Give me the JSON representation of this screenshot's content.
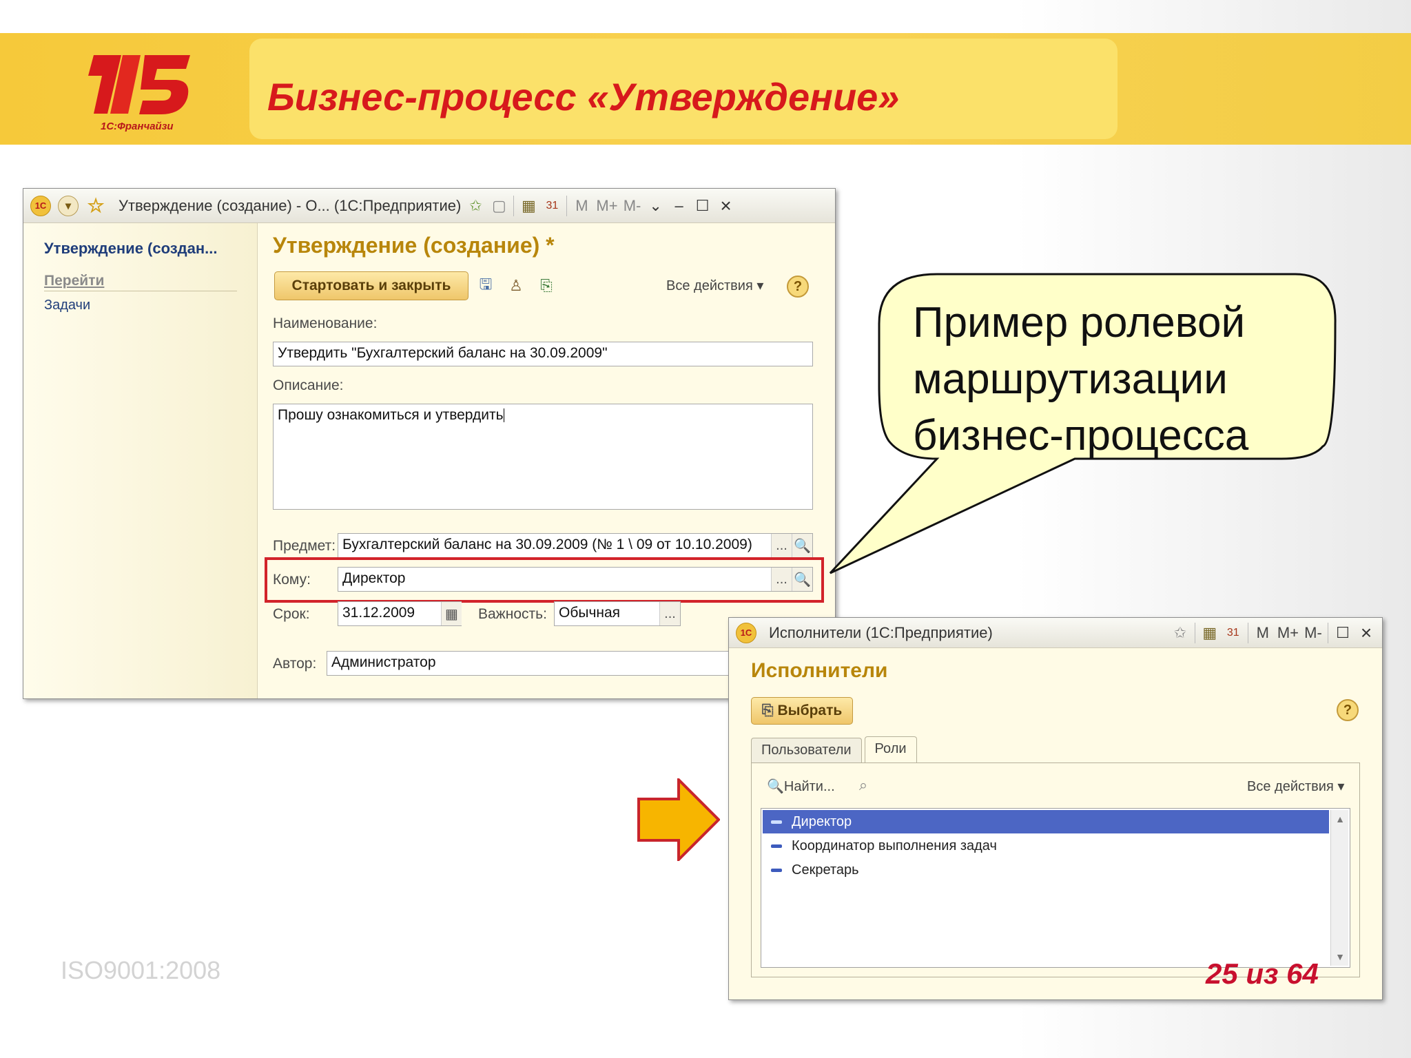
{
  "slide": {
    "title": "Бизнес-процесс «Утверждение»",
    "logo_text": "1С:Франчайзи",
    "iso": "ISO9001:2008",
    "page_num": "25 из 64",
    "callout": [
      "Пример ролевой",
      "маршрутизации",
      "бизнес-процесса"
    ]
  },
  "win1": {
    "title": "Утверждение (создание) - О... (1С:Предприятие)",
    "toolbar": [
      "M",
      "M+",
      "M-"
    ],
    "side": {
      "title": "Утверждение (создан...",
      "section": "Перейти",
      "link": "Задачи"
    },
    "form_title": "Утверждение (создание) *",
    "start_btn": "Стартовать и закрыть",
    "all_actions": "Все действия",
    "help": "?",
    "name_label": "Наименование:",
    "name_value": "Утвердить \"Бухгалтерский баланс на 30.09.2009\"",
    "desc_label": "Описание:",
    "desc_value": "Прошу ознакомиться и утвердить",
    "subject_label": "Предмет:",
    "subject_value": "Бухгалтерский баланс на 30.09.2009 (№ 1 \\ 09 от 10.10.2009)",
    "to_label": "Кому:",
    "to_value": "Директор",
    "due_label": "Срок:",
    "due_value": "31.12.2009",
    "importance_label": "Важность:",
    "importance_value": "Обычная",
    "author_label": "Автор:",
    "author_value": "Администратор",
    "dots": "..."
  },
  "win2": {
    "title": "Исполнители  (1С:Предприятие)",
    "toolbar": [
      "M",
      "M+",
      "M-"
    ],
    "heading": "Исполнители",
    "choose_btn": "Выбрать",
    "help": "?",
    "tabs": [
      "Пользователи",
      "Роли"
    ],
    "find": "Найти...",
    "all_actions": "Все действия",
    "rows": [
      "Директор",
      "Координатор выполнения задач",
      "Секретарь"
    ],
    "selected_row": 0
  },
  "colors": {
    "title_red": "#d7191c",
    "banner_yellow": "#f6c93a",
    "selection_blue": "#4c66c4",
    "highlight_red": "#d2232a",
    "arrow_orange": "#f7b500"
  },
  "icons": [
    "logo-1c-icon",
    "dropdown-icon",
    "star-icon",
    "favorites-icon",
    "calculator-icon",
    "calendar-icon",
    "minimize-icon",
    "maximize-icon",
    "close-icon",
    "save-icon",
    "search-icon",
    "arrow-right-icon"
  ]
}
